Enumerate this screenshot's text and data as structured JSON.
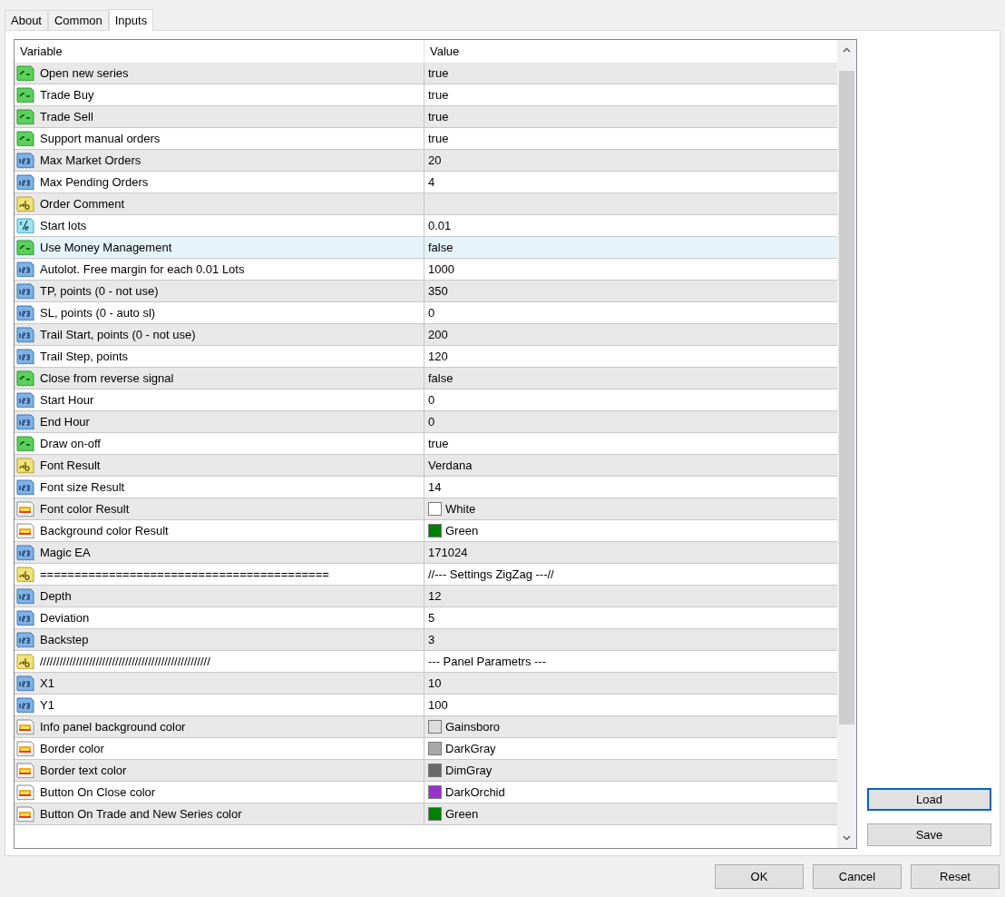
{
  "tabs": [
    {
      "label": "About",
      "selected": false
    },
    {
      "label": "Common",
      "selected": false
    },
    {
      "label": "Inputs",
      "selected": true
    }
  ],
  "table": {
    "columns": [
      "Variable",
      "Value"
    ],
    "rows": [
      {
        "kind": "bool",
        "variable": "Open new series",
        "value": "true",
        "selected": false
      },
      {
        "kind": "bool",
        "variable": "Trade Buy",
        "value": "true",
        "selected": false
      },
      {
        "kind": "bool",
        "variable": "Trade Sell",
        "value": "true",
        "selected": false
      },
      {
        "kind": "bool",
        "variable": "Support manual orders",
        "value": "true",
        "selected": false
      },
      {
        "kind": "int",
        "variable": "Max Market Orders",
        "value": "20",
        "selected": false
      },
      {
        "kind": "int",
        "variable": "Max Pending Orders",
        "value": "4",
        "selected": false
      },
      {
        "kind": "string",
        "variable": "Order Comment",
        "selected": false
      },
      {
        "kind": "double",
        "variable": "Start lots",
        "value": "0.01",
        "selected": false
      },
      {
        "kind": "bool",
        "variable": "Use Money Management",
        "value": "false",
        "selected": true
      },
      {
        "kind": "int",
        "variable": "Autolot. Free margin for each 0.01 Lots",
        "value": "1000",
        "selected": false
      },
      {
        "kind": "int",
        "variable": "TP, points (0 - not use)",
        "value": "350",
        "selected": false
      },
      {
        "kind": "int",
        "variable": "SL, points (0 - auto sl)",
        "value": "0",
        "selected": false
      },
      {
        "kind": "int",
        "variable": "Trail Start, points (0 - not use)",
        "value": "200",
        "selected": false
      },
      {
        "kind": "int",
        "variable": "Trail Step, points",
        "value": "120",
        "selected": false
      },
      {
        "kind": "bool",
        "variable": "Close from reverse signal",
        "value": "false",
        "selected": false
      },
      {
        "kind": "int",
        "variable": "Start Hour",
        "value": "0",
        "selected": false
      },
      {
        "kind": "int",
        "variable": "End Hour",
        "value": "0",
        "selected": false
      },
      {
        "kind": "bool",
        "variable": "Draw on-off",
        "value": "true",
        "selected": false
      },
      {
        "kind": "string",
        "variable": "Font Result",
        "value": "Verdana",
        "selected": false
      },
      {
        "kind": "int",
        "variable": "Font size Result",
        "value": "14",
        "selected": false
      },
      {
        "kind": "color",
        "variable": "Font color Result",
        "value": "White",
        "color": "#ffffff",
        "selected": false
      },
      {
        "kind": "color",
        "variable": "Background color Result",
        "value": "Green",
        "color": "#008000",
        "selected": false
      },
      {
        "kind": "int",
        "variable": "Magic EA",
        "value": "171024",
        "selected": false
      },
      {
        "kind": "string",
        "variable": "==========================================",
        "value": "//--- Settings ZigZag ---//",
        "selected": false
      },
      {
        "kind": "int",
        "variable": "Depth",
        "value": "12",
        "selected": false
      },
      {
        "kind": "int",
        "variable": "Deviation",
        "value": "5",
        "selected": false
      },
      {
        "kind": "int",
        "variable": "Backstep",
        "value": "3",
        "selected": false
      },
      {
        "kind": "string",
        "variable": "////////////////////////////////////////////////////",
        "value": "--- Panel Parametrs ---",
        "selected": false
      },
      {
        "kind": "int",
        "variable": "X1",
        "value": "10",
        "selected": false
      },
      {
        "kind": "int",
        "variable": "Y1",
        "value": "100",
        "selected": false
      },
      {
        "kind": "color",
        "variable": "Info panel background color",
        "value": "Gainsboro",
        "color": "#dcdcdc",
        "selected": false
      },
      {
        "kind": "color",
        "variable": "Border color",
        "value": "DarkGray",
        "color": "#a9a9a9",
        "selected": false
      },
      {
        "kind": "color",
        "variable": "Border text color",
        "value": "DimGray",
        "color": "#696969",
        "selected": false
      },
      {
        "kind": "color",
        "variable": "Button On Close color",
        "value": "DarkOrchid",
        "color": "#9932cc",
        "selected": false
      },
      {
        "kind": "color",
        "variable": "Button On Trade and New Series color",
        "value": "Green",
        "color": "#008000",
        "selected": false
      }
    ]
  },
  "side_buttons": [
    {
      "label": "Load",
      "focused": true
    },
    {
      "label": "Save",
      "focused": false
    }
  ],
  "buttons": [
    "OK",
    "Cancel",
    "Reset"
  ]
}
